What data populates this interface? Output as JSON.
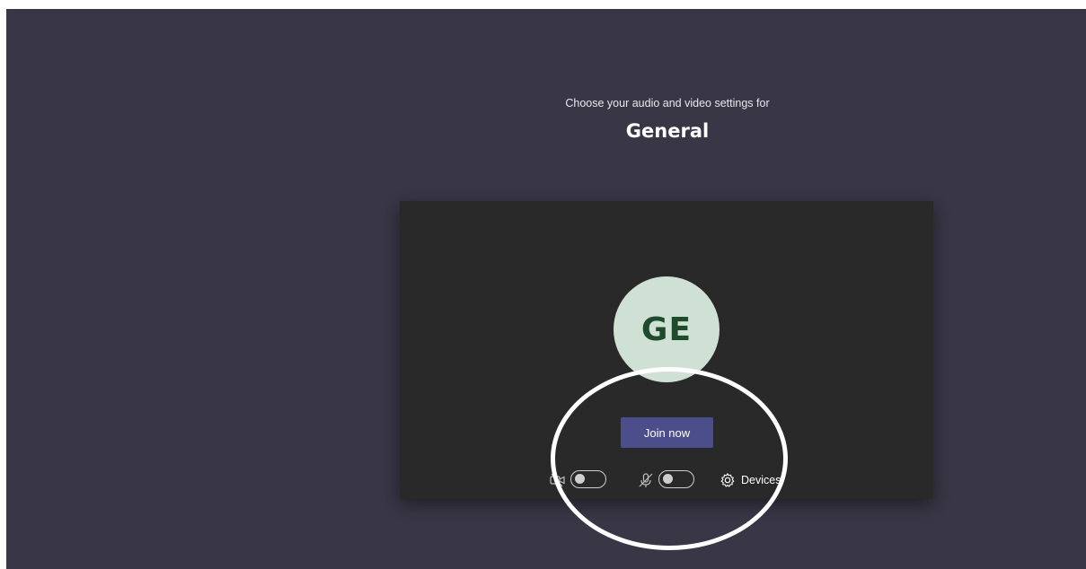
{
  "prejoin": {
    "subtitle": "Choose your audio and video settings for",
    "meeting_title": "General"
  },
  "preview": {
    "avatar_initials": "GE",
    "join_label": "Join now"
  },
  "controls": {
    "camera": {
      "icon": "camera-off-icon",
      "state": "off"
    },
    "microphone": {
      "icon": "mic-off-icon",
      "state": "off"
    },
    "devices": {
      "icon": "gear-icon",
      "label": "Devices"
    }
  },
  "colors": {
    "background": "#393746",
    "preview_bg": "#292929",
    "avatar_bg": "#cfe0d4",
    "avatar_text": "#1f4a2c",
    "primary_button": "#4b4e8a",
    "annotation_ring": "#ffffff"
  }
}
